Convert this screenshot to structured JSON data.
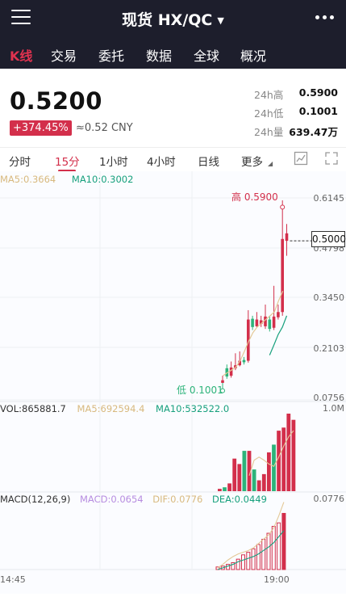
{
  "header": {
    "title": "现货 HX/QC",
    "tabs": [
      {
        "label": "K线"
      },
      {
        "label": "交易"
      },
      {
        "label": "委托"
      },
      {
        "label": "数据"
      },
      {
        "label": "全球"
      },
      {
        "label": "概况"
      }
    ]
  },
  "quote": {
    "price": "0.5200",
    "change": "+374.45%",
    "cny": "≈0.52 CNY",
    "stats": [
      {
        "label": "24h高",
        "value": "0.5900"
      },
      {
        "label": "24h低",
        "value": "0.1001"
      },
      {
        "label": "24h量",
        "value": "639.47万"
      }
    ]
  },
  "timeframes": [
    "分时",
    "15分",
    "1小时",
    "4小时",
    "日线",
    "更多"
  ],
  "chart": {
    "ma_legend": {
      "ma5": "MA5:0.3664",
      "ma10": "MA10:0.3002"
    },
    "price_axis": [
      "0.6145",
      "0.4798",
      "0.3450",
      "0.2103",
      "0.0756"
    ],
    "current_price_label": "0.5000",
    "high_label": "高 0.5900",
    "low_label": "低 0.1001",
    "vol_legend": {
      "vol": "VOL:865881.7",
      "ma5": "MA5:692594.4",
      "ma10": "MA10:532522.0"
    },
    "vol_axis_max": "1.0M",
    "macd_legend": {
      "macd": "MACD(12,26,9)",
      "value": "MACD:0.0654",
      "dif": "DIF:0.0776",
      "dea": "DEA:0.0449"
    },
    "macd_axis_max": "0.0776",
    "time_labels": [
      "14:45",
      "19:00"
    ]
  },
  "colors": {
    "up": "#d32f4b",
    "down": "#2db37a",
    "ma5": "#e4c896",
    "ma10": "#17a07d",
    "macd": "#b78de0",
    "bg_dark": "#1d1e2c"
  },
  "chart_data": {
    "type": "candlestick",
    "candles": [
      {
        "o": 0.121,
        "c": 0.128,
        "h": 0.14,
        "l": 0.108,
        "up": true
      },
      {
        "o": 0.16,
        "c": 0.138,
        "h": 0.17,
        "l": 0.132,
        "up": false
      },
      {
        "o": 0.14,
        "c": 0.162,
        "h": 0.178,
        "l": 0.135,
        "up": true
      },
      {
        "o": 0.16,
        "c": 0.168,
        "h": 0.2,
        "l": 0.155,
        "up": true
      },
      {
        "o": 0.168,
        "c": 0.18,
        "h": 0.205,
        "l": 0.165,
        "up": true
      },
      {
        "o": 0.182,
        "c": 0.176,
        "h": 0.19,
        "l": 0.17,
        "up": false
      },
      {
        "o": 0.18,
        "c": 0.29,
        "h": 0.315,
        "l": 0.175,
        "up": true
      },
      {
        "o": 0.292,
        "c": 0.27,
        "h": 0.3,
        "l": 0.262,
        "up": false
      },
      {
        "o": 0.272,
        "c": 0.29,
        "h": 0.31,
        "l": 0.268,
        "up": true
      },
      {
        "o": 0.288,
        "c": 0.278,
        "h": 0.3,
        "l": 0.27,
        "up": true
      },
      {
        "o": 0.272,
        "c": 0.298,
        "h": 0.33,
        "l": 0.265,
        "up": true
      },
      {
        "o": 0.29,
        "c": 0.265,
        "h": 0.3,
        "l": 0.258,
        "up": false
      },
      {
        "o": 0.268,
        "c": 0.298,
        "h": 0.38,
        "l": 0.262,
        "up": true
      },
      {
        "o": 0.296,
        "c": 0.31,
        "h": 0.33,
        "l": 0.29,
        "up": true
      },
      {
        "o": 0.31,
        "c": 0.505,
        "h": 0.59,
        "l": 0.3,
        "up": true
      },
      {
        "o": 0.52,
        "c": 0.5,
        "h": 0.545,
        "l": 0.46,
        "up": true
      }
    ],
    "ma5": [
      0.14,
      0.148,
      0.155,
      0.163,
      0.18,
      0.205,
      0.232,
      0.255,
      0.27,
      0.28,
      0.29,
      0.3,
      0.31,
      0.34,
      0.366
    ],
    "ma10": [
      0.195,
      0.222,
      0.25,
      0.27,
      0.3
    ],
    "volume": {
      "values": [
        0.03,
        0.05,
        0.1,
        0.42,
        0.35,
        0.52,
        0.52,
        0.28,
        0.14,
        0.22,
        0.5,
        0.6,
        0.78,
        0.82,
        1.0,
        0.92
      ],
      "up": [
        true,
        false,
        true,
        true,
        true,
        false,
        true,
        false,
        true,
        true,
        true,
        false,
        true,
        true,
        true,
        true
      ]
    },
    "volume_ma5": [
      0.2,
      0.4,
      0.44,
      0.4,
      0.35,
      0.32,
      0.44,
      0.58,
      0.7,
      0.78
    ],
    "macd": {
      "hist": [
        0.003,
        0.004,
        0.006,
        0.008,
        0.012,
        0.017,
        0.02,
        0.024,
        0.029,
        0.035,
        0.042,
        0.05,
        0.054,
        0.065
      ],
      "dif": [
        0.002,
        0.006,
        0.011,
        0.015,
        0.018,
        0.02,
        0.022,
        0.025,
        0.03,
        0.035,
        0.04,
        0.048,
        0.062,
        0.078
      ],
      "dea": [
        0.0,
        0.002,
        0.004,
        0.006,
        0.009,
        0.011,
        0.013,
        0.015,
        0.018,
        0.022,
        0.026,
        0.031,
        0.038,
        0.045
      ]
    },
    "y_range": [
      0.0756,
      0.6145
    ]
  }
}
